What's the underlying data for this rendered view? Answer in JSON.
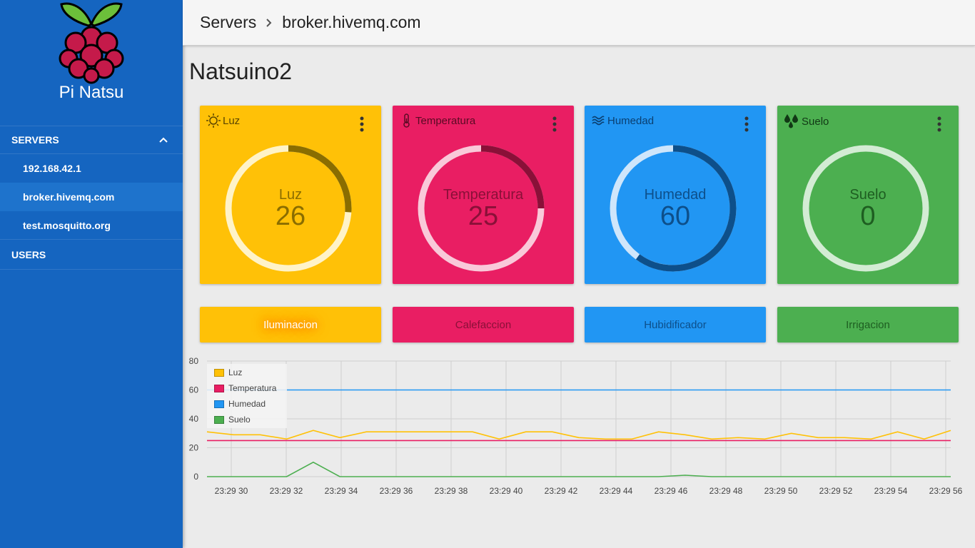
{
  "sidebar": {
    "brand": "Pi Natsu",
    "section_servers": "SERVERS",
    "servers": [
      {
        "label": "192.168.42.1"
      },
      {
        "label": "broker.hivemq.com"
      },
      {
        "label": "test.mosquitto.org"
      }
    ],
    "section_users": "USERS"
  },
  "header": {
    "breadcrumb_root": "Servers",
    "breadcrumb_current": "broker.hivemq.com"
  },
  "page": {
    "title": "Natsuino2"
  },
  "cards": [
    {
      "label": "Luz",
      "gauge_name": "Luz",
      "value": "26",
      "fraction": 0.26,
      "color": "#ffc107",
      "ring": "#fff3c8",
      "arc": "#8a6d00",
      "text": "#8a6d00",
      "icon": "sun-icon"
    },
    {
      "label": "Temperatura",
      "gauge_name": "Temperatura",
      "value": "25",
      "fraction": 0.25,
      "color": "#e91e63",
      "ring": "#f9c9d9",
      "arc": "#8a1038",
      "text": "#8a1038",
      "icon": "thermometer-icon"
    },
    {
      "label": "Humedad",
      "gauge_name": "Humedad",
      "value": "60",
      "fraction": 0.6,
      "color": "#2196f3",
      "ring": "#cfe6fb",
      "arc": "#0d4f8a",
      "text": "#0d4f8a",
      "icon": "waves-icon"
    },
    {
      "label": "Suelo",
      "gauge_name": "Suelo",
      "value": "0",
      "fraction": 0.0,
      "color": "#4caf50",
      "ring": "#d3ecd4",
      "arc": "#1e5e21",
      "text": "#1e5e21",
      "icon": "droplets-icon"
    }
  ],
  "actions": [
    {
      "label": "Iluminacion",
      "color": "#ffc107",
      "text": "#ffffff"
    },
    {
      "label": "Calefaccion",
      "color": "#e91e63",
      "text": "#8a1038"
    },
    {
      "label": "Hubidificador",
      "color": "#2196f3",
      "text": "#0d4f8a"
    },
    {
      "label": "Irrigacion",
      "color": "#4caf50",
      "text": "#1e5e21"
    }
  ],
  "chart_data": {
    "type": "line",
    "x": [
      "23:29 30",
      "23:29 31",
      "23:29 32",
      "23:29 33",
      "23:29 34",
      "23:29 35",
      "23:29 36",
      "23:29 37",
      "23:29 38",
      "23:29 39",
      "23:29 40",
      "23:29 41",
      "23:29 42",
      "23:29 43",
      "23:29 44",
      "23:29 45",
      "23:29 46",
      "23:29 47",
      "23:29 48",
      "23:29 49",
      "23:29 50",
      "23:29 51",
      "23:29 52",
      "23:29 53",
      "23:29 54",
      "23:29 55",
      "23:29 56"
    ],
    "x_tick_labels": [
      "23:29 30",
      "23:29 32",
      "23:29 34",
      "23:29 36",
      "23:29 38",
      "23:29 40",
      "23:29 42",
      "23:29 44",
      "23:29 46",
      "23:29 48",
      "23:29 50",
      "23:29 52",
      "23:29 54",
      "23:29 56"
    ],
    "y_ticks": [
      0,
      20,
      40,
      60,
      80
    ],
    "ylim": [
      0,
      80
    ],
    "grid": true,
    "legend_position": "top-left",
    "series": [
      {
        "name": "Luz",
        "color": "#ffc107",
        "values": [
          31,
          29,
          29,
          26,
          32,
          27,
          31,
          31,
          31,
          31,
          31,
          26,
          31,
          31,
          27,
          26,
          26,
          31,
          29,
          26,
          27,
          26,
          30,
          27,
          27,
          26,
          31,
          26,
          32
        ]
      },
      {
        "name": "Temperatura",
        "color": "#e91e63",
        "values": [
          25,
          25,
          25,
          25,
          25,
          25,
          25,
          25,
          25,
          25,
          25,
          25,
          25,
          25,
          25,
          25,
          25,
          25,
          25,
          25,
          25,
          25,
          25,
          25,
          25,
          25,
          25,
          25,
          25
        ]
      },
      {
        "name": "Humedad",
        "color": "#2196f3",
        "values": [
          60,
          60,
          60,
          60,
          60,
          60,
          60,
          60,
          60,
          60,
          60,
          60,
          60,
          60,
          60,
          60,
          60,
          60,
          60,
          60,
          60,
          60,
          60,
          60,
          60,
          60,
          60,
          60,
          60
        ]
      },
      {
        "name": "Suelo",
        "color": "#4caf50",
        "values": [
          0,
          0,
          0,
          0,
          10,
          0,
          0,
          0,
          0,
          0,
          0,
          0,
          0,
          0,
          0,
          0,
          0,
          0,
          1,
          0,
          0,
          0,
          0,
          0,
          0,
          0,
          0,
          0,
          0
        ]
      }
    ]
  }
}
